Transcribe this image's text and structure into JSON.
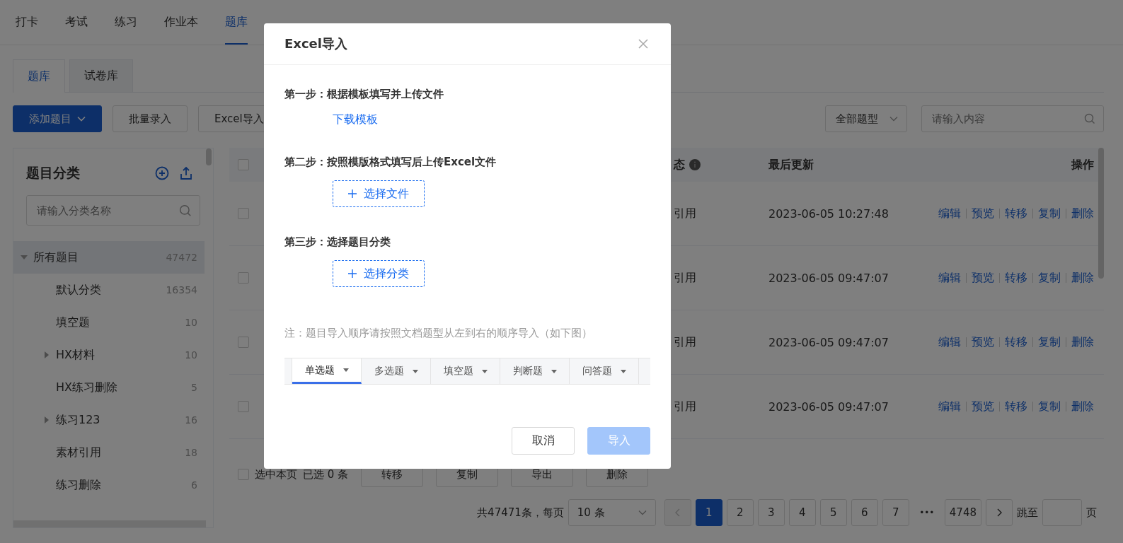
{
  "nav": {
    "items": [
      {
        "label": "打卡",
        "selected": false
      },
      {
        "label": "考试",
        "selected": false
      },
      {
        "label": "练习",
        "selected": false
      },
      {
        "label": "作业本",
        "selected": false
      },
      {
        "label": "题库",
        "selected": true
      }
    ]
  },
  "library_tabs": [
    {
      "label": "题库",
      "selected": true
    },
    {
      "label": "试卷库",
      "selected": false
    }
  ],
  "toolbar": {
    "buttons": [
      {
        "label": "添加题目",
        "kind": "primary-dropdown"
      },
      {
        "label": "批量录入",
        "kind": "default"
      },
      {
        "label": "Excel导入",
        "kind": "default"
      }
    ],
    "type_select": "全部题型",
    "search": {
      "placeholder": "请输入内容"
    }
  },
  "category_panel": {
    "title": "题目分类",
    "search": {
      "placeholder": "请输入分类名称"
    },
    "tree": [
      {
        "label": "所有题目",
        "count": "47472",
        "kind": "folder",
        "expanded": true,
        "selected": true,
        "children": [
          {
            "label": "默认分类",
            "count": "16354",
            "kind": "leaf",
            "selected": false
          },
          {
            "label": "填空题",
            "count": "10",
            "kind": "leaf",
            "selected": false
          },
          {
            "label": "HX材料",
            "count": "10",
            "kind": "folder",
            "expanded": false,
            "selected": false
          },
          {
            "label": "HX练习删除",
            "count": "5",
            "kind": "leaf",
            "selected": false
          },
          {
            "label": "练习123",
            "count": "16",
            "kind": "folder",
            "expanded": false,
            "selected": false
          },
          {
            "label": "素材引用",
            "count": "18",
            "kind": "leaf",
            "selected": false
          },
          {
            "label": "练习删除",
            "count": "6",
            "kind": "leaf",
            "selected": false
          }
        ]
      }
    ]
  },
  "table": {
    "all_checked": false,
    "columns": [
      "态",
      "最后更新",
      "操作"
    ],
    "rows": [
      {
        "checked": false,
        "status": "引用",
        "updated": "2023-06-05 10:27:48",
        "actions": [
          "编辑",
          "预览",
          "转移",
          "复制",
          "删除"
        ]
      },
      {
        "checked": false,
        "status": "引用",
        "updated": "2023-06-05 09:47:07",
        "actions": [
          "编辑",
          "预览",
          "转移",
          "复制",
          "删除"
        ]
      },
      {
        "checked": false,
        "status": "引用",
        "updated": "2023-06-05 09:47:07",
        "actions": [
          "编辑",
          "预览",
          "转移",
          "复制",
          "删除"
        ]
      },
      {
        "checked": false,
        "status": "引用",
        "updated": "2023-06-05 09:47:07",
        "actions": [
          "编辑",
          "预览",
          "转移",
          "复制",
          "删除"
        ]
      }
    ]
  },
  "batch": {
    "select_page": {
      "label": "选中本页",
      "checked": false
    },
    "selected_count": "已选 0 条",
    "buttons": [
      "转移",
      "复制",
      "导出",
      "删除"
    ]
  },
  "pagination": {
    "total": "共47471条，每页",
    "page_size": "10 条",
    "pages": [
      {
        "label": "1",
        "kind": "page",
        "selected": true
      },
      {
        "label": "2",
        "kind": "page",
        "selected": false
      },
      {
        "label": "3",
        "kind": "page",
        "selected": false
      },
      {
        "label": "4",
        "kind": "page",
        "selected": false
      },
      {
        "label": "5",
        "kind": "page",
        "selected": false
      },
      {
        "label": "6",
        "kind": "page",
        "selected": false
      },
      {
        "label": "7",
        "kind": "page",
        "selected": false
      },
      {
        "label": "•••",
        "kind": "ellipsis"
      },
      {
        "label": "4748",
        "kind": "page",
        "selected": false
      }
    ],
    "jump_label": "跳至",
    "page_suffix": "页"
  },
  "dialog": {
    "title": "Excel导入",
    "steps": [
      {
        "title": "第一步：根据模板填写并上传文件",
        "kind": "link",
        "action": "下载模板"
      },
      {
        "title": "第二步：按照模版格式填写后上传Excel文件",
        "kind": "upload",
        "action": "选择文件"
      },
      {
        "title": "第三步：选择题目分类",
        "kind": "upload",
        "action": "选择分类"
      }
    ],
    "note": "注：题目导入顺序请按照文档题型从左到右的顺序导入（如下图）",
    "sheet_tabs": [
      {
        "label": "单选题",
        "selected": true
      },
      {
        "label": "多选题",
        "selected": false
      },
      {
        "label": "填空题",
        "selected": false
      },
      {
        "label": "判断题",
        "selected": false
      },
      {
        "label": "问答题",
        "selected": false
      }
    ],
    "cancel": "取消",
    "confirm": {
      "label": "导入",
      "disabled": true
    }
  }
}
